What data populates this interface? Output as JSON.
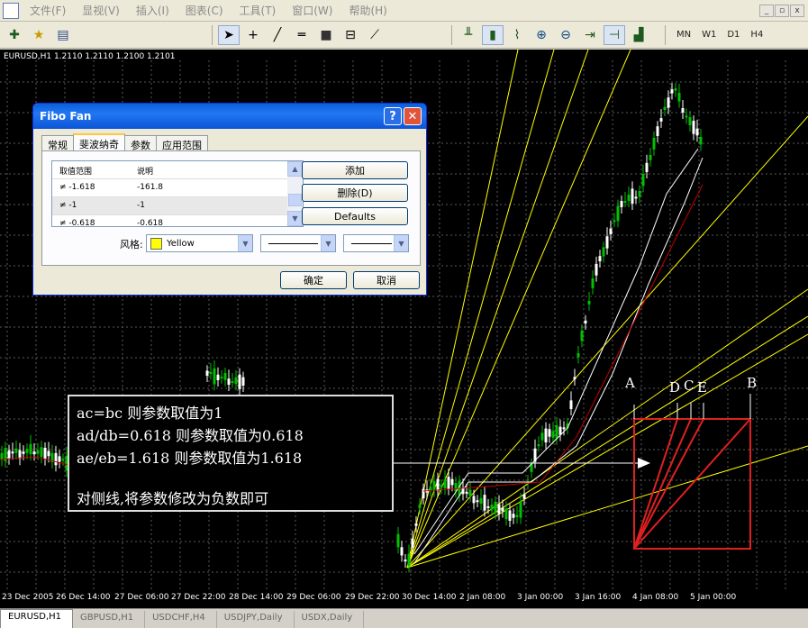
{
  "menu": [
    "文件(F)",
    "显视(V)",
    "插入(I)",
    "图表(C)",
    "工具(T)",
    "窗口(W)",
    "帮助(H)"
  ],
  "window_controls": [
    "_",
    "▫",
    "x"
  ],
  "toolbar": {
    "timeframes": [
      "MN",
      "W1",
      "D1",
      "H4"
    ]
  },
  "chart": {
    "info": "EURUSD,H1  1.2110 1.2110 1.2100 1.2101",
    "x_labels": [
      "23 Dec 2005",
      "26 Dec 14:00",
      "27 Dec 06:00",
      "27 Dec 22:00",
      "28 Dec 14:00",
      "29 Dec 06:00",
      "29 Dec 22:00",
      "30 Dec 14:00",
      "2 Jan 08:00",
      "3 Jan 00:00",
      "3 Jan 16:00",
      "4 Jan 08:00",
      "5 Jan 00:00"
    ],
    "point_labels": {
      "a": "A",
      "b": "B",
      "d": "D",
      "c": "C",
      "e": "E"
    },
    "colors": {
      "background": "#000000",
      "grid": "#5a5a5a",
      "fan": "#ffff00",
      "bull": "#00c000",
      "bear": "#ffffff",
      "ma_red": "#c00000"
    }
  },
  "annotation": {
    "line1": "ac=bc 则参数取值为1",
    "line2": "ad/db=0.618 则参数取值为0.618",
    "line3": "ae/eb=1.618 则参数取值为1.618",
    "line4": "对侧线,将参数修改为负数即可"
  },
  "dialog": {
    "title": "Fibo Fan",
    "tabs": [
      "常规",
      "斐波纳奇",
      "参数",
      "应用范围"
    ],
    "list_headers": [
      "取值范围",
      "说明"
    ],
    "rows": [
      {
        "level": "-1.618",
        "desc": "-161.8"
      },
      {
        "level": "-1",
        "desc": "-1"
      },
      {
        "level": "-0.618",
        "desc": "-0.618"
      }
    ],
    "add_button": "添加",
    "delete_button": "删除(D)",
    "defaults_button": "Defaults",
    "style_label": "风格:",
    "color_value": "Yellow",
    "ok_button": "确定",
    "cancel_button": "取消"
  },
  "tabs": [
    "EURUSD,H1",
    "GBPUSD,H1",
    "USDCHF,H4",
    "USDJPY,Daily",
    "USDX,Daily"
  ]
}
